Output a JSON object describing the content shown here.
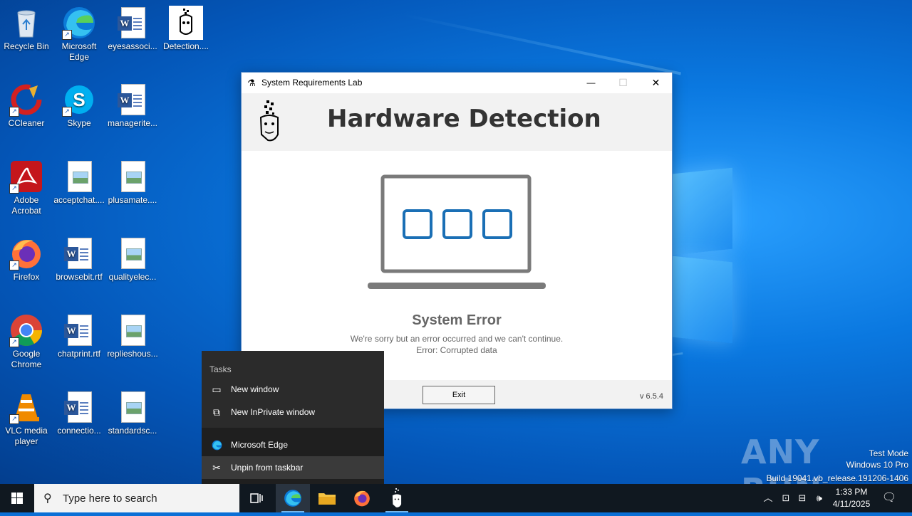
{
  "desktop": {
    "icons": [
      {
        "label": "Recycle Bin",
        "icon": "recycle-bin-icon"
      },
      {
        "label": "Microsoft Edge",
        "icon": "edge-icon"
      },
      {
        "label": "eyesassoci...",
        "icon": "word-doc-icon"
      },
      {
        "label": "Detection....",
        "icon": "detection-app-icon"
      },
      {
        "label": "CCleaner",
        "icon": "ccleaner-icon"
      },
      {
        "label": "Skype",
        "icon": "skype-icon"
      },
      {
        "label": "managerite...",
        "icon": "word-doc-icon"
      },
      {
        "label": "Adobe Acrobat",
        "icon": "acrobat-icon"
      },
      {
        "label": "acceptchat....",
        "icon": "image-file-icon"
      },
      {
        "label": "plusamate....",
        "icon": "image-file-icon"
      },
      {
        "label": "Firefox",
        "icon": "firefox-icon"
      },
      {
        "label": "browsebit.rtf",
        "icon": "word-doc-icon"
      },
      {
        "label": "qualityelec...",
        "icon": "image-file-icon"
      },
      {
        "label": "Google Chrome",
        "icon": "chrome-icon"
      },
      {
        "label": "chatprint.rtf",
        "icon": "word-doc-icon"
      },
      {
        "label": "replieshous...",
        "icon": "image-file-icon"
      },
      {
        "label": "VLC media player",
        "icon": "vlc-icon"
      },
      {
        "label": "connectio...",
        "icon": "word-doc-icon"
      },
      {
        "label": "standardsc...",
        "icon": "image-file-icon"
      }
    ]
  },
  "window": {
    "title": "System Requirements Lab",
    "header": "Hardware Detection",
    "error_title": "System Error",
    "error_line1": "We're sorry but an error occurred and we can't continue.",
    "error_line2": "Error: Corrupted data",
    "exit_label": "Exit",
    "version": "v 6.5.4",
    "minimize": "—",
    "maximize": "☐",
    "close": "✕"
  },
  "jumplist": {
    "section": "Tasks",
    "items": [
      {
        "label": "New window",
        "icon": "window-icon"
      },
      {
        "label": "New InPrivate window",
        "icon": "inprivate-icon"
      },
      {
        "label": "Microsoft Edge",
        "icon": "edge-icon"
      },
      {
        "label": "Unpin from taskbar",
        "icon": "unpin-icon"
      }
    ]
  },
  "watermark": {
    "brand": "ANY RUN",
    "line1": "Test Mode",
    "line2": "Windows 10 Pro",
    "line3": "Build 19041.vb_release.191206-1406"
  },
  "taskbar": {
    "search_placeholder": "Type here to search",
    "time": "1:33 PM",
    "date": "4/11/2025"
  },
  "colors": {
    "accent": "#0a78e0",
    "laptop_squares": "#1a6fb5",
    "laptop_frame": "#7a7a7a"
  }
}
